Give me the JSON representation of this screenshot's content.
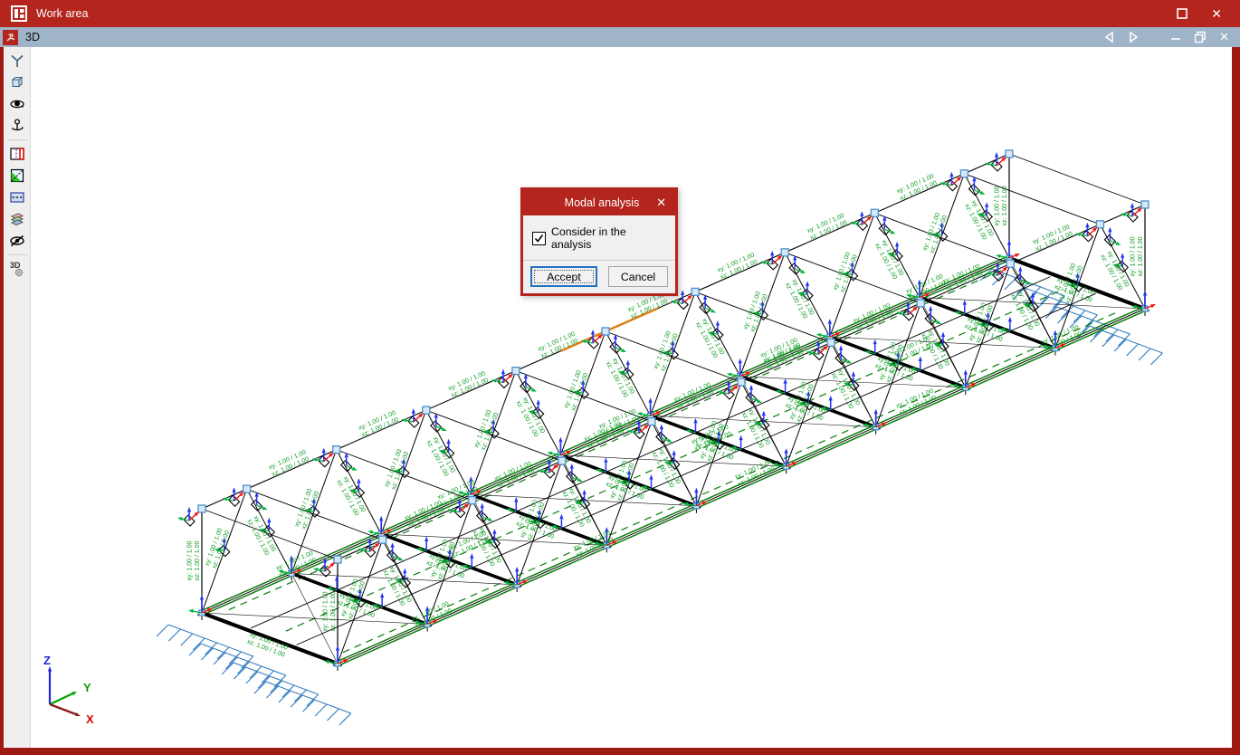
{
  "window": {
    "title": "Work area",
    "icon": "work-area-icon",
    "controls": {
      "maximize_icon": "maximize-icon",
      "close_glyph": "✕"
    }
  },
  "tabbar": {
    "tab_label": "3D",
    "tab_icon": "3d-model-icon",
    "controls": {
      "icons": [
        "prev-view-icon",
        "next-view-icon",
        "minimize-icon",
        "restore-icon",
        "close-icon"
      ],
      "close_glyph": "✕"
    }
  },
  "toolbar": {
    "icons": [
      "view-axes-icon",
      "cube-3d-view-icon",
      "orbit-eye-icon",
      "rotate-orbit-icon",
      "work-plane-icon",
      "plane-selection-icon",
      "section-plane-icon",
      "layers-icon",
      "hide-elements-icon",
      "3d-settings-icon"
    ]
  },
  "dialog": {
    "title": "Modal analysis",
    "close_glyph": "✕",
    "checkbox_label": "Consider in the analysis",
    "checkbox_checked": true,
    "accept_label": "Accept",
    "cancel_label": "Cancel"
  },
  "axis_triad": {
    "x_label": "X",
    "y_label": "Y",
    "z_label": "Z"
  },
  "scene": {
    "member_label_line1": "xy: 1.00 / 1.00",
    "member_label_line2": "xz: 1.00 / 1.00",
    "origin": [
      223,
      677
    ],
    "length_vec": [
      892,
      -392
    ],
    "width_vec": [
      150,
      56
    ],
    "height": 115,
    "bays": 9,
    "orange_segment": [
      0.445,
      0.565
    ],
    "colors": {
      "member": "#000000",
      "deck_green": "#0a7d0a",
      "label_green": "#089b1e",
      "arrow_green": "#00b33c",
      "arrow_blue": "#2233ee",
      "arrow_red": "#ee1111",
      "support_blue": "#2e79c0",
      "node_square_fill": "#d6e7f7",
      "node_square_stroke": "#4a90cf",
      "orange": "#dd7d14",
      "axis_x": "#8b1a1a",
      "axis_y": "#00a000",
      "axis_z": "#2222dd",
      "axis_x_label": "#e00000"
    }
  }
}
